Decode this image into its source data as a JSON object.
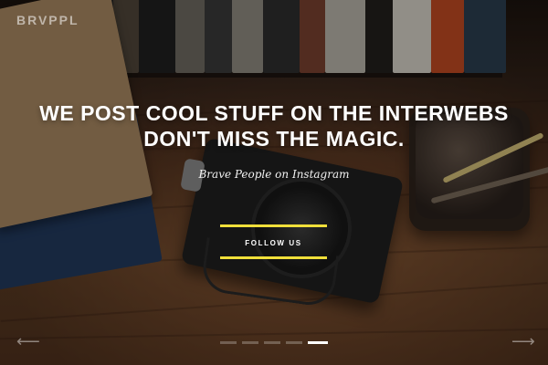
{
  "brand": {
    "logo_text": "BRVPPL"
  },
  "hero": {
    "headline_line1": "WE POST COOL STUFF ON THE INTERWEBS",
    "headline_line2": "DON'T MISS THE MAGIC.",
    "subhead": "Brave People on Instagram",
    "cta_label": "FOLLOW US"
  },
  "carousel": {
    "slides_count": 5,
    "active_index": 4
  },
  "colors": {
    "accent": "#f0df3a",
    "text": "#ffffff"
  },
  "icons": {
    "prev": "arrow-left-icon",
    "next": "arrow-right-icon"
  }
}
